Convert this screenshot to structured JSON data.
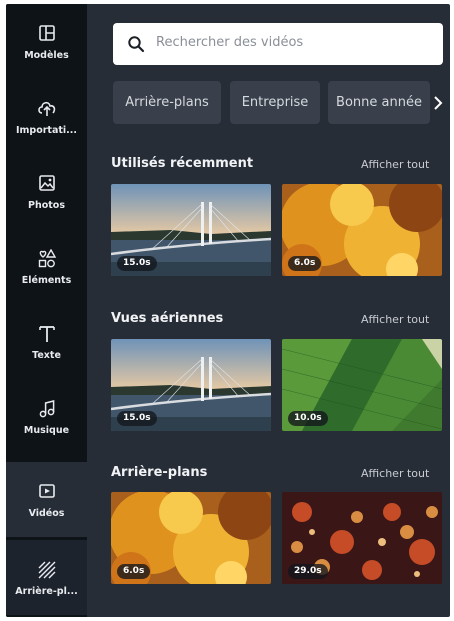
{
  "sidebar": {
    "items": [
      {
        "label": "Modèles",
        "icon": "template-icon"
      },
      {
        "label": "Importati...",
        "icon": "upload-cloud-icon"
      },
      {
        "label": "Photos",
        "icon": "image-icon"
      },
      {
        "label": "Éléments",
        "icon": "shapes-icon"
      },
      {
        "label": "Texte",
        "icon": "text-icon"
      },
      {
        "label": "Musique",
        "icon": "music-note-icon"
      },
      {
        "label": "Vidéos",
        "icon": "video-icon"
      },
      {
        "label": "Arrière-pl...",
        "icon": "hatch-pattern-icon"
      }
    ],
    "active_index": 6
  },
  "search": {
    "placeholder": "Rechercher des vidéos"
  },
  "chips": [
    "Arrière-plans",
    "Entreprise",
    "Bonne année"
  ],
  "sections": [
    {
      "title": "Utilisés récemment",
      "link": "Afficher tout",
      "videos": [
        {
          "duration": "15.0s",
          "scene": "bridge"
        },
        {
          "duration": "6.0s",
          "scene": "ink"
        }
      ]
    },
    {
      "title": "Vues aériennes",
      "link": "Afficher tout",
      "videos": [
        {
          "duration": "15.0s",
          "scene": "bridge"
        },
        {
          "duration": "10.0s",
          "scene": "field"
        }
      ]
    },
    {
      "title": "Arrière-plans",
      "link": "Afficher tout",
      "videos": [
        {
          "duration": "6.0s",
          "scene": "ink"
        },
        {
          "duration": "29.0s",
          "scene": "bokeh"
        }
      ]
    }
  ],
  "colors": {
    "sidebar": "#0e1318",
    "panel": "#262d37",
    "chip": "#39404b"
  }
}
